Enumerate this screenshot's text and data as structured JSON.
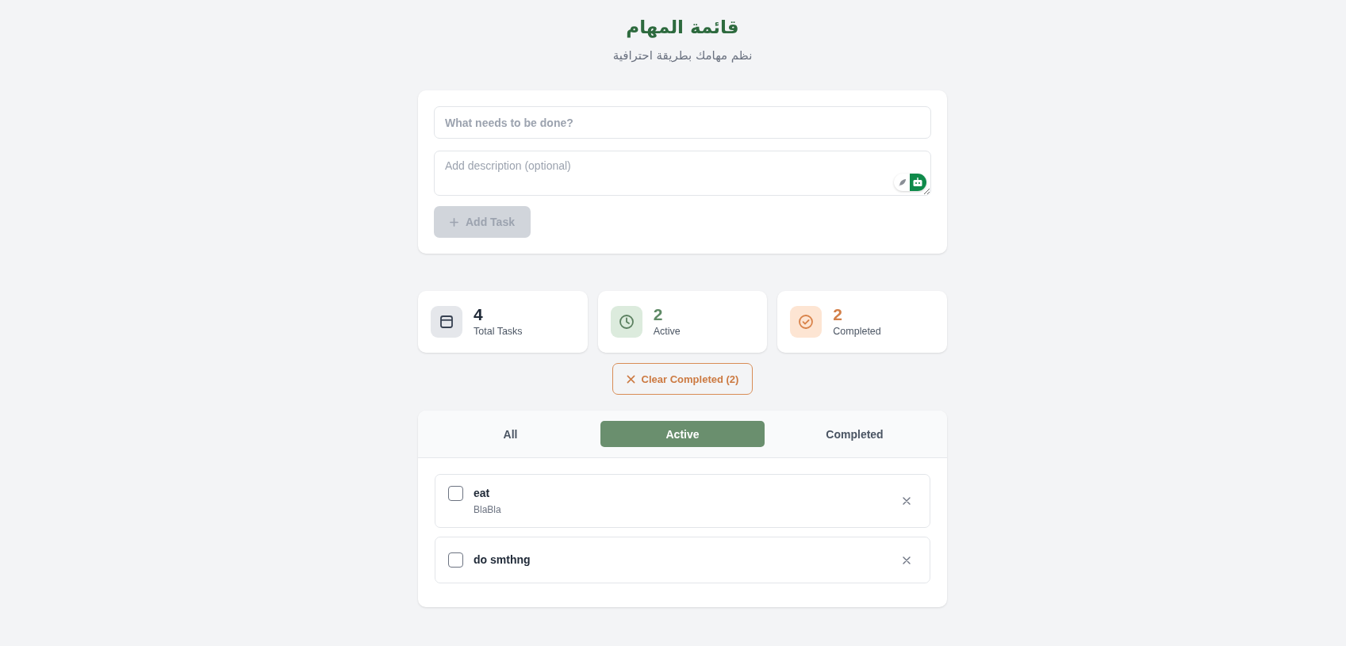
{
  "header": {
    "title": "قائمة المهام",
    "subtitle": "نظم مهامك بطريقة احترافية"
  },
  "new_task_form": {
    "title_field": {
      "placeholder": "What needs to be done?"
    },
    "description_field": {
      "placeholder": "Add description (optional)"
    },
    "add_button": {
      "label": "Add Task",
      "disabled": true
    }
  },
  "stats": [
    {
      "kind": "total",
      "value": "4",
      "label": "Total Tasks"
    },
    {
      "kind": "active",
      "value": "2",
      "label": "Active"
    },
    {
      "kind": "completed",
      "value": "2",
      "label": "Completed"
    }
  ],
  "clear_button": {
    "label": "Clear Completed (2)"
  },
  "filter_tabs": [
    {
      "label": "All",
      "selected": false
    },
    {
      "label": "Active",
      "selected": true
    },
    {
      "label": "Completed",
      "selected": false
    }
  ],
  "tasks": [
    {
      "title": "eat",
      "description": "BlaBla",
      "completed": false
    },
    {
      "title": "do smthng",
      "completed": false
    }
  ]
}
